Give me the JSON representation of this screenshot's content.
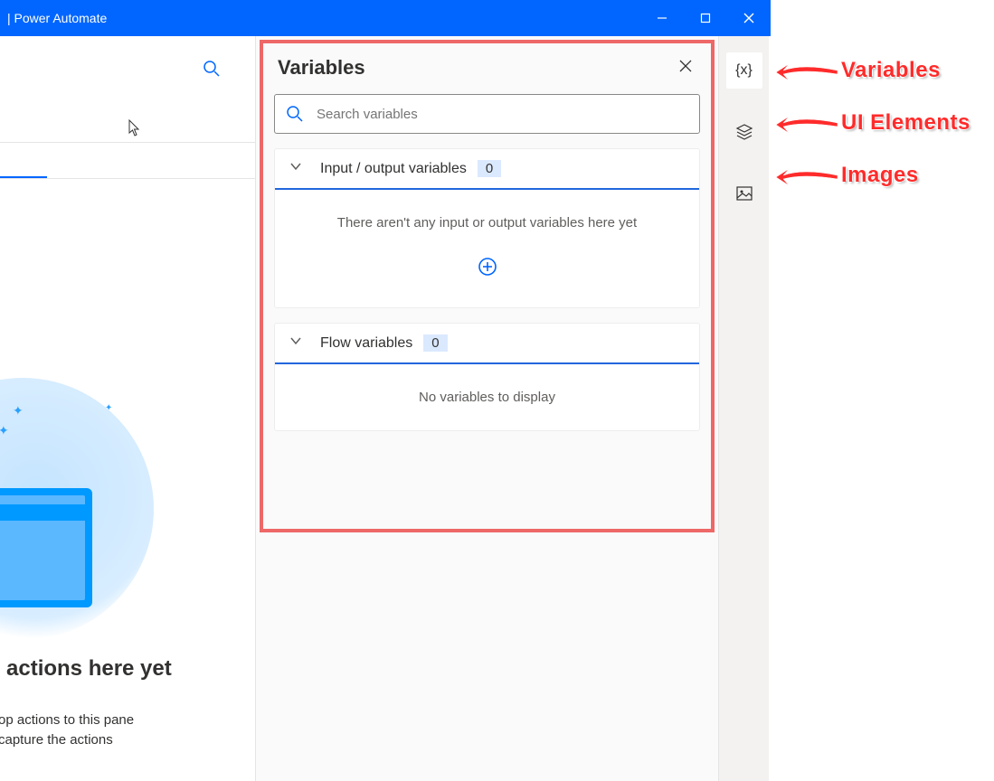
{
  "titlebar": {
    "title": "| Power Automate"
  },
  "panel": {
    "title": "Variables",
    "search_placeholder": "Search variables",
    "io": {
      "title": "Input / output variables",
      "count": "0",
      "empty": "There aren't any input or output variables here yet"
    },
    "flow": {
      "title": "Flow variables",
      "count": "0",
      "empty": "No variables to display"
    }
  },
  "empty_state": {
    "title": "actions here yet",
    "line1": "op actions to this pane",
    "line2": "capture the actions"
  },
  "annotations": {
    "variables": "Variables",
    "ui_elements": "UI Elements",
    "images": "Images"
  }
}
